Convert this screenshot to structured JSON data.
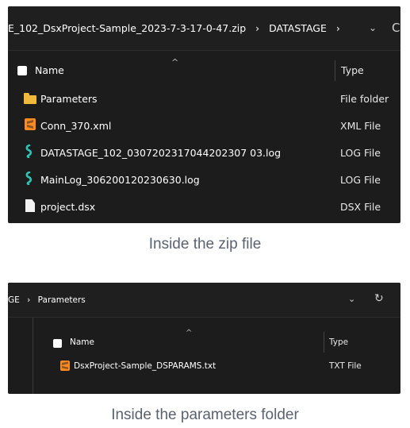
{
  "top_panel": {
    "address": {
      "path_prefix": "E_102_DsxProject-Sample_2023-7-3-17-0-47.zip",
      "separator": "›",
      "path_current": "DATASTAGE",
      "trailing_separator": "›",
      "dropdown_icon": "chevron-down",
      "refresh_icon": "refresh-partial"
    },
    "columns": {
      "name": "Name",
      "type": "Type",
      "sort_indicator": "^"
    },
    "files": [
      {
        "name": "Parameters",
        "type": "File folder",
        "icon": "folder"
      },
      {
        "name": "Conn_370.xml",
        "type": "XML File",
        "icon": "sublime-text"
      },
      {
        "name": "DATASTAGE_102_0307202317044202307 03.log",
        "type": "LOG File",
        "icon": "log-worm"
      },
      {
        "name": "MainLog_306200120230630.log",
        "type": "LOG File",
        "icon": "log-worm"
      },
      {
        "name": "project.dsx",
        "type": "DSX File",
        "icon": "document"
      }
    ]
  },
  "caption_1": "Inside the zip file",
  "bottom_panel": {
    "address": {
      "path_prefix": "GE",
      "separator": "›",
      "path_current": "Parameters",
      "dropdown_icon": "chevron-down",
      "refresh_icon": "refresh"
    },
    "columns": {
      "name": "Name",
      "type": "Type",
      "sort_indicator": "^"
    },
    "files": [
      {
        "name": "DsxProject-Sample_DSPARAMS.txt",
        "type": "TXT File",
        "icon": "sublime-text"
      }
    ]
  },
  "caption_2": "Inside the parameters folder",
  "colors": {
    "panel_bg": "#1c1c1c",
    "folder": "#f1b93c",
    "sublime": "#ff8a1f",
    "log": "#2ec4b6",
    "caption": "#5a6270"
  }
}
